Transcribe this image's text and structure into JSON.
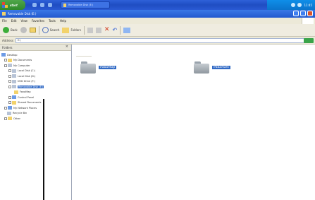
{
  "taskbar": {
    "start_label": "start",
    "task_label": "Removable Disk (E:)",
    "clock": "11:45"
  },
  "window": {
    "title": "Removable Disk (E:)"
  },
  "menu": {
    "items": [
      "File",
      "Edit",
      "View",
      "Favorites",
      "Tools",
      "Help"
    ]
  },
  "toolbar": {
    "back_label": "Back",
    "search_label": "Search",
    "folders_label": "Folders"
  },
  "address": {
    "label": "Address",
    "value": "E:\\"
  },
  "leftpane": {
    "header": "Folders",
    "tree": [
      {
        "label": "Desktop",
        "icon": "desktop",
        "selected": false
      },
      {
        "label": "My Documents",
        "icon": "folder",
        "selected": false
      },
      {
        "label": "My Computer",
        "icon": "computer",
        "selected": false
      },
      {
        "label": "Local Disk (C:)",
        "icon": "drive",
        "selected": false
      },
      {
        "label": "Local Disk (D:)",
        "icon": "drive",
        "selected": false
      },
      {
        "label": "DVD Drive (F:)",
        "icon": "drive",
        "selected": false
      },
      {
        "label": "Removable Disk (E:)",
        "icon": "drive",
        "selected": true
      },
      {
        "label": "FanaMap",
        "icon": "folder",
        "selected": false
      },
      {
        "label": "Control Panel",
        "icon": "folder",
        "selected": false
      },
      {
        "label": "Shared Documents",
        "icon": "folder",
        "selected": false
      },
      {
        "label": "My Network Places",
        "icon": "network",
        "selected": false
      },
      {
        "label": "Recycle Bin",
        "icon": "recycle",
        "selected": false
      },
      {
        "label": "Other",
        "icon": "folder",
        "selected": false
      }
    ]
  },
  "files": [
    {
      "name": "PanaMap"
    },
    {
      "name": "PanaNavi"
    }
  ]
}
